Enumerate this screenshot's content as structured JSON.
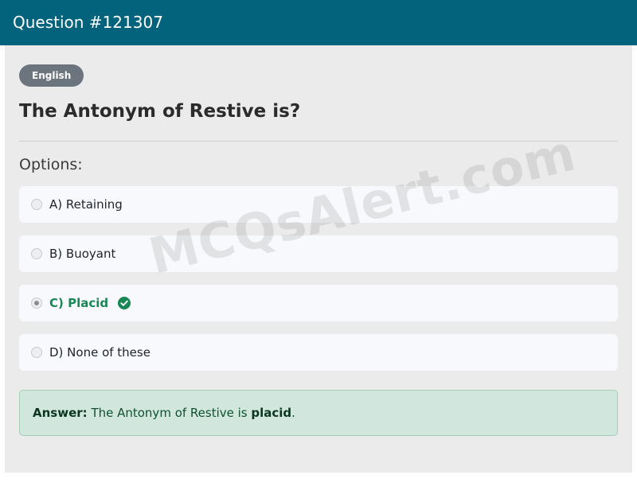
{
  "header": {
    "title": "Question #121307"
  },
  "question": {
    "language_badge": "English",
    "text": "The Antonym of Restive is?"
  },
  "options_section": {
    "heading": "Options:",
    "options": [
      {
        "label": "A) Retaining",
        "selected": false,
        "correct": false
      },
      {
        "label": "B) Buoyant",
        "selected": false,
        "correct": false
      },
      {
        "label": "C) Placid",
        "selected": true,
        "correct": true,
        "icon": "check-circle-icon"
      },
      {
        "label": "D) None of these",
        "selected": false,
        "correct": false
      }
    ]
  },
  "answer": {
    "prefix": "Answer:",
    "sentence_start": "The Antonym of Restive is",
    "answer_word": "placid",
    "sentence_end": "."
  },
  "watermark": {
    "text": "MCQsAlert.com"
  },
  "colors": {
    "header_bg": "#03627c",
    "correct_green": "#198754",
    "answer_bg": "#d1e7dd"
  }
}
